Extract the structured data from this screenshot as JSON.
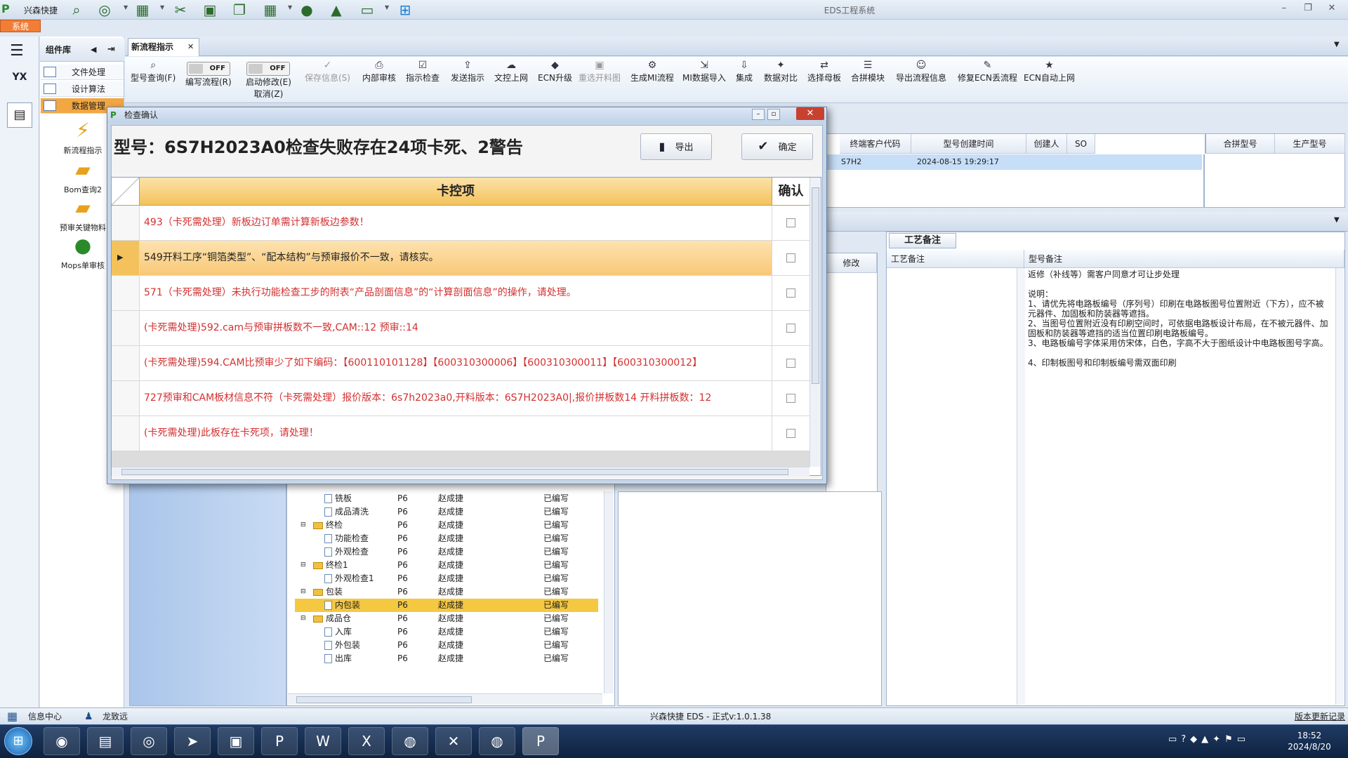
{
  "window": {
    "app_name": "兴森快捷",
    "title": "EDS工程系统",
    "sys_tab": "系统"
  },
  "left": {
    "comp_header": "组件库",
    "items": [
      "文件处理",
      "设计算法",
      "数据管理"
    ],
    "tools": [
      "新流程指示",
      "Bom查询2",
      "预审关键物料",
      "Mops单审核"
    ]
  },
  "tab": {
    "label": "新流程指示"
  },
  "ribbon": {
    "buttons": [
      "型号查询(F)",
      "编写流程(R)",
      "启动修改(E)",
      "保存信息(S)",
      "内部审核",
      "指示检查",
      "发送指示",
      "文控上网",
      "ECN升级",
      "重选开料图",
      "生成MI流程",
      "MI数据导入",
      "集成",
      "数据对比",
      "选择母板",
      "合拼模块",
      "导出流程信息",
      "修复ECN丢流程",
      "ECN自动上网"
    ],
    "toggle_off": "OFF",
    "cancel_label": "取消(Z)"
  },
  "bg_grid": {
    "headers": [
      "终端客户代码",
      "型号创建时间",
      "创建人",
      "SO",
      "合拼型号",
      "生产型号"
    ],
    "row": {
      "customer": "S7H2",
      "created": "2024-08-15 19:29:17"
    },
    "modify_header": "修改"
  },
  "process_note": {
    "tab": "工艺备注",
    "col1": "工艺备注",
    "col2": "型号备注",
    "lines": [
      "返修（补线等）需客户同意才可让步处理",
      "",
      "说明：",
      "1、请优先将电路板编号（序列号）印刷在电路板图号位置附近（下方），应不被",
      "元器件、加固板和防装器等遮挡。",
      "2、当图号位置附近没有印刷空间时，可依据电路板设计布局，在不被元器件、加",
      "固板和防装器等遮挡的适当位置印刷电路板编号。",
      "3、电路板编号字体采用仿宋体，白色，字高不大于图纸设计中电路板图号字高。",
      "",
      "4、印制板图号和印制板编号需双面印刷"
    ]
  },
  "tree": {
    "rows": [
      {
        "name": "铣板",
        "code": "P6",
        "user": "赵成捷",
        "status": "已编写",
        "type": "doc"
      },
      {
        "name": "成品清洗",
        "code": "P6",
        "user": "赵成捷",
        "status": "已编写",
        "type": "doc"
      },
      {
        "name": "终检",
        "code": "P6",
        "user": "赵成捷",
        "status": "已编写",
        "type": "folder"
      },
      {
        "name": "功能检查",
        "code": "P6",
        "user": "赵成捷",
        "status": "已编写",
        "type": "doc"
      },
      {
        "name": "外观检查",
        "code": "P6",
        "user": "赵成捷",
        "status": "已编写",
        "type": "doc"
      },
      {
        "name": "终检1",
        "code": "P6",
        "user": "赵成捷",
        "status": "已编写",
        "type": "folder"
      },
      {
        "name": "外观检查1",
        "code": "P6",
        "user": "赵成捷",
        "status": "已编写",
        "type": "doc"
      },
      {
        "name": "包装",
        "code": "P6",
        "user": "赵成捷",
        "status": "已编写",
        "type": "folder"
      },
      {
        "name": "内包装",
        "code": "P6",
        "user": "赵成捷",
        "status": "已编写",
        "type": "doc"
      },
      {
        "name": "成品仓",
        "code": "P6",
        "user": "赵成捷",
        "status": "已编写",
        "type": "folder"
      },
      {
        "name": "入库",
        "code": "P6",
        "user": "赵成捷",
        "status": "已编写",
        "type": "doc"
      },
      {
        "name": "外包装",
        "code": "P6",
        "user": "赵成捷",
        "status": "已编写",
        "type": "doc"
      },
      {
        "name": "出库",
        "code": "P6",
        "user": "赵成捷",
        "status": "已编写",
        "type": "doc"
      }
    ]
  },
  "dialog": {
    "title": "检查确认",
    "heading": "型号：6S7H2023A0检查失败存在24项卡死、2警告",
    "export_label": "导出",
    "ok_label": "确定",
    "col_item": "卡控项",
    "col_confirm": "确认",
    "rows": [
      "493（卡死需处理）新板边订单需计算新板边参数！",
      "549开料工序“铜箔类型”、“配本结构”与预审报价不一致，请核实。",
      "571（卡死需处理）未执行功能检查工步的附表“产品剖面信息”的“计算剖面信息”的操作，请处理。",
      "(卡死需处理)592.cam与预审拼板数不一致,CAM::12 预审::14",
      "(卡死需处理)594.CAM比预审少了如下编码：【600110101128】【600310300006】【600310300011】【600310300012】",
      "727预审和CAM板材信息不符（卡死需处理）报价版本：6s7h2023a0,开料版本：6S7H2023A0|,报价拼板数14 开料拼板数：12",
      "(卡死需处理)此板存在卡死项，请处理！"
    ]
  },
  "status": {
    "info": "信息中心",
    "user": "龙致远",
    "version": "兴森快捷 EDS - 正式v:1.0.1.38",
    "update": "版本更新记录"
  },
  "clock": {
    "time": "18:52",
    "date": "2024/8/20"
  }
}
